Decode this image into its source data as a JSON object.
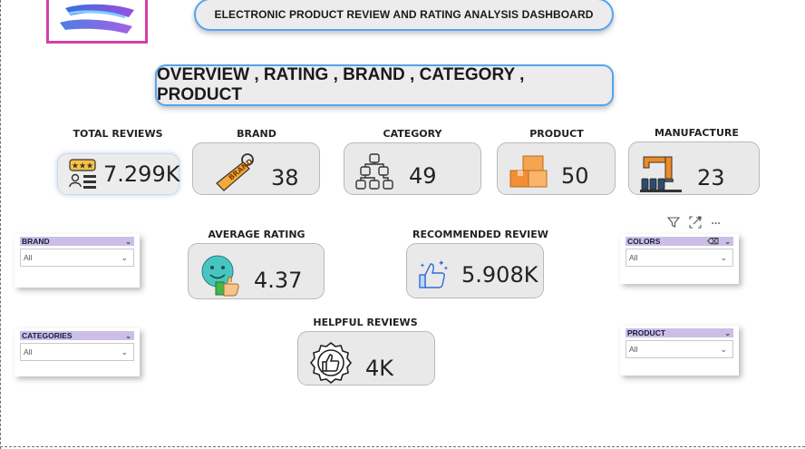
{
  "header": {
    "title": "ELECTRONIC PRODUCT REVIEW AND RATING ANALYSIS DASHBOARD",
    "subtitle": "OVERVIEW , RATING , BRAND , CATEGORY , PRODUCT"
  },
  "logo": {
    "icon": "brand-logo-icon"
  },
  "kpis": {
    "total_reviews": {
      "label": "TOTAL REVIEWS",
      "value": "7.299K",
      "icon": "rating-reviews-icon"
    },
    "brand": {
      "label": "BRAND",
      "value": "38",
      "icon": "brand-tag-icon"
    },
    "category": {
      "label": "CATEGORY",
      "value": "49",
      "icon": "hierarchy-icon"
    },
    "product": {
      "label": "PRODUCT",
      "value": "50",
      "icon": "boxes-icon"
    },
    "manufacture": {
      "label": "MANUFACTURE",
      "value": "23",
      "icon": "factory-robot-icon"
    },
    "average_rating": {
      "label": "AVERAGE RATING",
      "value": "4.37",
      "icon": "smiley-thumbs-up-icon"
    },
    "recommended_review": {
      "label": "RECOMMENDED REVIEW",
      "value": "5.908K",
      "icon": "recommend-thumbs-up-icon"
    },
    "helpful_reviews": {
      "label": "HELPFUL REVIEWS",
      "value": "4K",
      "icon": "thumbs-up-badge-icon"
    }
  },
  "slicers": {
    "brand": {
      "title": "BRAND",
      "value": "All"
    },
    "categories": {
      "title": "CATEGORIES",
      "value": "All"
    },
    "colors": {
      "title": "COLORS",
      "value": "All"
    },
    "product": {
      "title": "PRODUCT",
      "value": "All"
    }
  },
  "visual_header": {
    "icons": [
      "filter-icon",
      "focus-mode-icon",
      "more-options-icon"
    ],
    "more_glyph": "···"
  },
  "colors": {
    "accent_border": "#53a4f2",
    "slicer_header": "#cbbfe8",
    "logo_border": "#d43fa8",
    "card_bg": "#e9e9e9"
  }
}
